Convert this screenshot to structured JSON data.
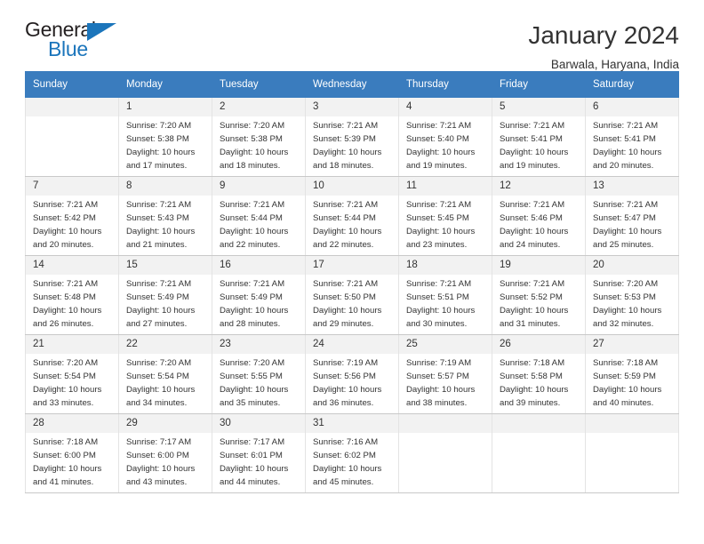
{
  "brand": {
    "name_top": "General",
    "name_bottom": "Blue",
    "triangle_color": "#1b75bb",
    "text_color": "#231f20"
  },
  "header": {
    "title": "January 2024",
    "subtitle": "Barwala, Haryana, India"
  },
  "theme": {
    "header_bg": "#3a7cbe",
    "header_text": "#ffffff",
    "daynum_bg": "#f2f2f2",
    "body_text": "#333333",
    "grid_line": "#c9c9c9"
  },
  "weekday_headers": [
    "Sunday",
    "Monday",
    "Tuesday",
    "Wednesday",
    "Thursday",
    "Friday",
    "Saturday"
  ],
  "labels": {
    "sunrise_prefix": "Sunrise: ",
    "sunset_prefix": "Sunset: ",
    "daylight_prefix": "Daylight: "
  },
  "weeks": [
    [
      {
        "day": "",
        "sunrise": "",
        "sunset": "",
        "daylight": ""
      },
      {
        "day": "1",
        "sunrise": "Sunrise: 7:20 AM",
        "sunset": "Sunset: 5:38 PM",
        "daylight": "Daylight: 10 hours and 17 minutes."
      },
      {
        "day": "2",
        "sunrise": "Sunrise: 7:20 AM",
        "sunset": "Sunset: 5:38 PM",
        "daylight": "Daylight: 10 hours and 18 minutes."
      },
      {
        "day": "3",
        "sunrise": "Sunrise: 7:21 AM",
        "sunset": "Sunset: 5:39 PM",
        "daylight": "Daylight: 10 hours and 18 minutes."
      },
      {
        "day": "4",
        "sunrise": "Sunrise: 7:21 AM",
        "sunset": "Sunset: 5:40 PM",
        "daylight": "Daylight: 10 hours and 19 minutes."
      },
      {
        "day": "5",
        "sunrise": "Sunrise: 7:21 AM",
        "sunset": "Sunset: 5:41 PM",
        "daylight": "Daylight: 10 hours and 19 minutes."
      },
      {
        "day": "6",
        "sunrise": "Sunrise: 7:21 AM",
        "sunset": "Sunset: 5:41 PM",
        "daylight": "Daylight: 10 hours and 20 minutes."
      }
    ],
    [
      {
        "day": "7",
        "sunrise": "Sunrise: 7:21 AM",
        "sunset": "Sunset: 5:42 PM",
        "daylight": "Daylight: 10 hours and 20 minutes."
      },
      {
        "day": "8",
        "sunrise": "Sunrise: 7:21 AM",
        "sunset": "Sunset: 5:43 PM",
        "daylight": "Daylight: 10 hours and 21 minutes."
      },
      {
        "day": "9",
        "sunrise": "Sunrise: 7:21 AM",
        "sunset": "Sunset: 5:44 PM",
        "daylight": "Daylight: 10 hours and 22 minutes."
      },
      {
        "day": "10",
        "sunrise": "Sunrise: 7:21 AM",
        "sunset": "Sunset: 5:44 PM",
        "daylight": "Daylight: 10 hours and 22 minutes."
      },
      {
        "day": "11",
        "sunrise": "Sunrise: 7:21 AM",
        "sunset": "Sunset: 5:45 PM",
        "daylight": "Daylight: 10 hours and 23 minutes."
      },
      {
        "day": "12",
        "sunrise": "Sunrise: 7:21 AM",
        "sunset": "Sunset: 5:46 PM",
        "daylight": "Daylight: 10 hours and 24 minutes."
      },
      {
        "day": "13",
        "sunrise": "Sunrise: 7:21 AM",
        "sunset": "Sunset: 5:47 PM",
        "daylight": "Daylight: 10 hours and 25 minutes."
      }
    ],
    [
      {
        "day": "14",
        "sunrise": "Sunrise: 7:21 AM",
        "sunset": "Sunset: 5:48 PM",
        "daylight": "Daylight: 10 hours and 26 minutes."
      },
      {
        "day": "15",
        "sunrise": "Sunrise: 7:21 AM",
        "sunset": "Sunset: 5:49 PM",
        "daylight": "Daylight: 10 hours and 27 minutes."
      },
      {
        "day": "16",
        "sunrise": "Sunrise: 7:21 AM",
        "sunset": "Sunset: 5:49 PM",
        "daylight": "Daylight: 10 hours and 28 minutes."
      },
      {
        "day": "17",
        "sunrise": "Sunrise: 7:21 AM",
        "sunset": "Sunset: 5:50 PM",
        "daylight": "Daylight: 10 hours and 29 minutes."
      },
      {
        "day": "18",
        "sunrise": "Sunrise: 7:21 AM",
        "sunset": "Sunset: 5:51 PM",
        "daylight": "Daylight: 10 hours and 30 minutes."
      },
      {
        "day": "19",
        "sunrise": "Sunrise: 7:21 AM",
        "sunset": "Sunset: 5:52 PM",
        "daylight": "Daylight: 10 hours and 31 minutes."
      },
      {
        "day": "20",
        "sunrise": "Sunrise: 7:20 AM",
        "sunset": "Sunset: 5:53 PM",
        "daylight": "Daylight: 10 hours and 32 minutes."
      }
    ],
    [
      {
        "day": "21",
        "sunrise": "Sunrise: 7:20 AM",
        "sunset": "Sunset: 5:54 PM",
        "daylight": "Daylight: 10 hours and 33 minutes."
      },
      {
        "day": "22",
        "sunrise": "Sunrise: 7:20 AM",
        "sunset": "Sunset: 5:54 PM",
        "daylight": "Daylight: 10 hours and 34 minutes."
      },
      {
        "day": "23",
        "sunrise": "Sunrise: 7:20 AM",
        "sunset": "Sunset: 5:55 PM",
        "daylight": "Daylight: 10 hours and 35 minutes."
      },
      {
        "day": "24",
        "sunrise": "Sunrise: 7:19 AM",
        "sunset": "Sunset: 5:56 PM",
        "daylight": "Daylight: 10 hours and 36 minutes."
      },
      {
        "day": "25",
        "sunrise": "Sunrise: 7:19 AM",
        "sunset": "Sunset: 5:57 PM",
        "daylight": "Daylight: 10 hours and 38 minutes."
      },
      {
        "day": "26",
        "sunrise": "Sunrise: 7:18 AM",
        "sunset": "Sunset: 5:58 PM",
        "daylight": "Daylight: 10 hours and 39 minutes."
      },
      {
        "day": "27",
        "sunrise": "Sunrise: 7:18 AM",
        "sunset": "Sunset: 5:59 PM",
        "daylight": "Daylight: 10 hours and 40 minutes."
      }
    ],
    [
      {
        "day": "28",
        "sunrise": "Sunrise: 7:18 AM",
        "sunset": "Sunset: 6:00 PM",
        "daylight": "Daylight: 10 hours and 41 minutes."
      },
      {
        "day": "29",
        "sunrise": "Sunrise: 7:17 AM",
        "sunset": "Sunset: 6:00 PM",
        "daylight": "Daylight: 10 hours and 43 minutes."
      },
      {
        "day": "30",
        "sunrise": "Sunrise: 7:17 AM",
        "sunset": "Sunset: 6:01 PM",
        "daylight": "Daylight: 10 hours and 44 minutes."
      },
      {
        "day": "31",
        "sunrise": "Sunrise: 7:16 AM",
        "sunset": "Sunset: 6:02 PM",
        "daylight": "Daylight: 10 hours and 45 minutes."
      },
      {
        "day": "",
        "sunrise": "",
        "sunset": "",
        "daylight": ""
      },
      {
        "day": "",
        "sunrise": "",
        "sunset": "",
        "daylight": ""
      },
      {
        "day": "",
        "sunrise": "",
        "sunset": "",
        "daylight": ""
      }
    ]
  ]
}
